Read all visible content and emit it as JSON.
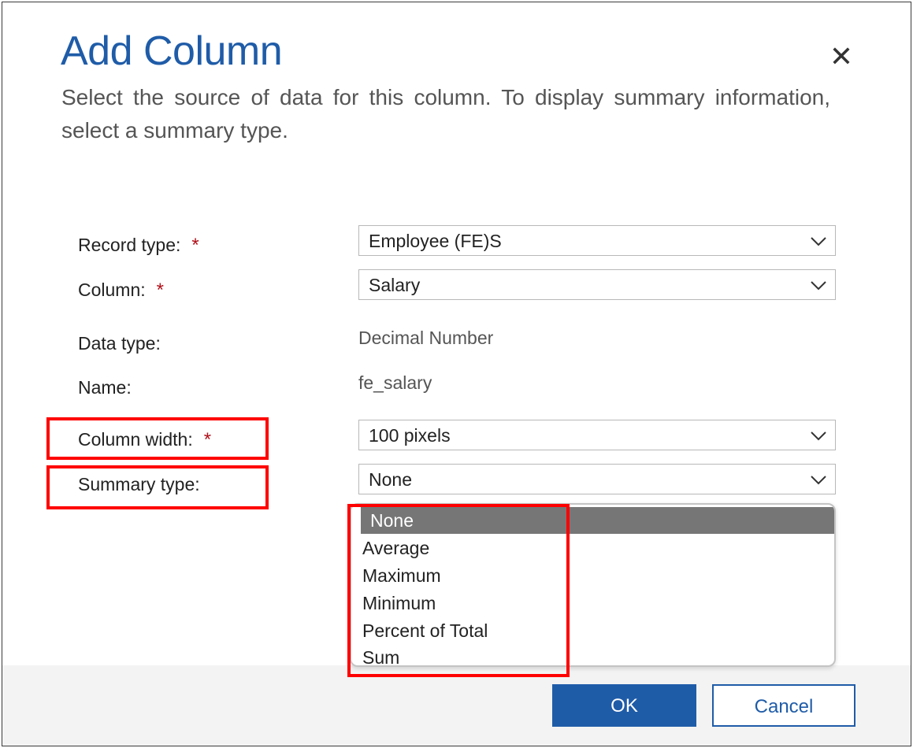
{
  "dialog": {
    "title": "Add Column",
    "description": "Select the source of data for this column. To display summary information, select a summary type.",
    "close_glyph": "✕"
  },
  "form": {
    "required_marker": "*",
    "record_type": {
      "label": "Record type:",
      "value": "Employee (FE)S",
      "required": true
    },
    "column": {
      "label": "Column:",
      "value": "Salary",
      "required": true
    },
    "data_type": {
      "label": "Data type:",
      "value": "Decimal Number"
    },
    "name": {
      "label": "Name:",
      "value": "fe_salary"
    },
    "column_width": {
      "label": "Column width:",
      "value": "100 pixels",
      "required": true
    },
    "summary_type": {
      "label": "Summary type:",
      "value": "None",
      "options": [
        "None",
        "Average",
        "Maximum",
        "Minimum",
        "Percent of Total",
        "Sum"
      ],
      "selected_option": "None"
    }
  },
  "buttons": {
    "ok": "OK",
    "cancel": "Cancel"
  },
  "icons": {
    "close": "close-icon",
    "chevron": "chevron-down-icon"
  },
  "colors": {
    "title": "#1f5ca8",
    "required": "#b0101a",
    "highlight": "#ff0000",
    "selected_option_bg": "#767676",
    "primary_button": "#1f5ca8"
  }
}
